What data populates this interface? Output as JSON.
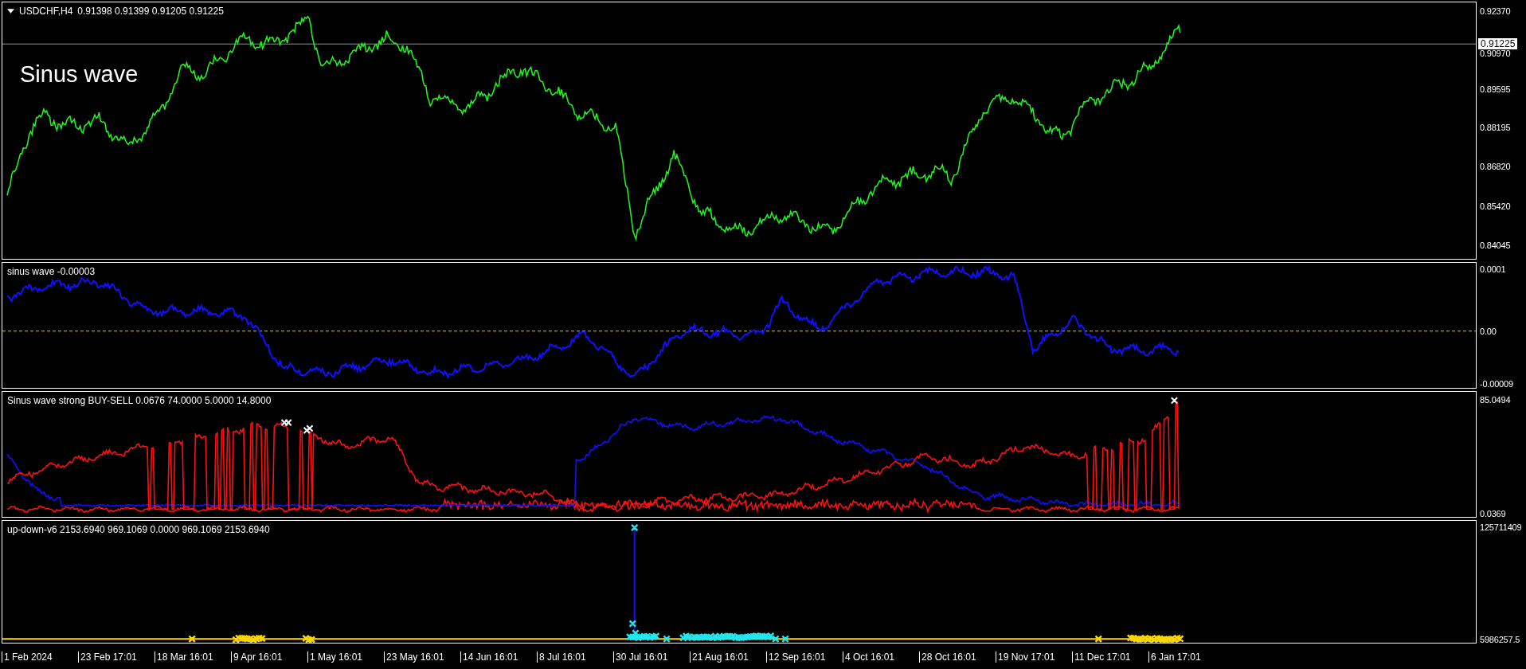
{
  "chart": {
    "symbol": "USDCHF,H4",
    "quotes": "0.91398 0.91399 0.91205 0.91225",
    "label": "Sinus wave",
    "price_scale": [
      "0.92370",
      "0.90970",
      "0.89595",
      "0.88195",
      "0.86820",
      "0.85420",
      "0.84045"
    ],
    "current_price": "0.91225"
  },
  "indicators": [
    {
      "kind": "oscillator",
      "title": "sinus wave -0.00003",
      "scale": [
        "0.0001",
        "0.00",
        "-0.00009"
      ]
    },
    {
      "kind": "buy_sell",
      "title": "Sinus wave strong BUY-SELL 0.0676 74.0000 5.0000 14.8000",
      "scale": [
        "85.0494",
        "0.0369"
      ]
    },
    {
      "kind": "up_down",
      "title": "up-down-v6 2153.6940 969.1069 0.0000 969.1069 2153.6940",
      "scale": [
        "125711409",
        "5986257.5"
      ]
    }
  ],
  "time_axis": [
    "1 Feb 2024",
    "23 Feb 17:01",
    "18 Mar 16:01",
    "9 Apr 16:01",
    "1 May 16:01",
    "23 May 16:01",
    "14 Jun 16:01",
    "8 Jul 16:01",
    "30 Jul 16:01",
    "21 Aug 16:01",
    "12 Sep 16:01",
    "4 Oct 16:01",
    "28 Oct 16:01",
    "19 Nov 17:01",
    "11 Dec 17:01",
    "6 Jan 17:01"
  ]
}
